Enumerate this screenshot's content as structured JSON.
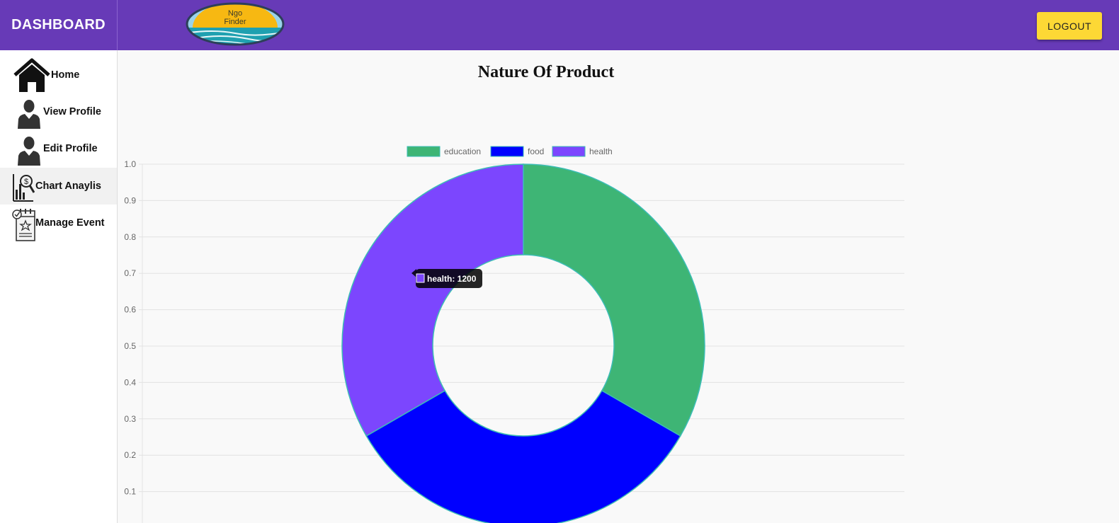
{
  "header": {
    "brand": "DASHBOARD",
    "logo_text_line1": "Ngo",
    "logo_text_line2": "Finder",
    "logout_label": "LOGOUT"
  },
  "sidebar": {
    "items": [
      {
        "label": "Home",
        "icon": "home-icon"
      },
      {
        "label": "View Profile",
        "icon": "user-icon"
      },
      {
        "label": "Edit Profile",
        "icon": "user-icon"
      },
      {
        "label": "Chart Anaylis",
        "icon": "chart-analysis-icon",
        "active": true
      },
      {
        "label": "Manage Event",
        "icon": "calendar-icon"
      }
    ]
  },
  "colors": {
    "header": "#673ab7",
    "logout": "#fdd835",
    "education": "#3eb575",
    "food": "#0000ff",
    "health": "#7c46fe"
  },
  "chart_data": {
    "type": "pie",
    "title": "Nature Of Product",
    "labels": [
      "education",
      "food",
      "health"
    ],
    "values": [
      1200,
      1200,
      1200
    ],
    "yticks": [
      "1.0",
      "0.9",
      "0.8",
      "0.7",
      "0.6",
      "0.5",
      "0.4",
      "0.3",
      "0.2",
      "0.1"
    ],
    "legend": "top",
    "grid": true,
    "tooltip": {
      "label": "health",
      "value": "1200",
      "text": "health: 1200"
    }
  }
}
